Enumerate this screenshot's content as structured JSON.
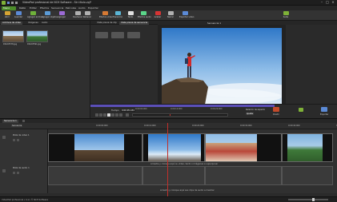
{
  "window": {
    "title": "VideoPad profesional de NCH Software - Sin título.vpj*"
  },
  "menubar": {
    "file_label": "Menú",
    "items": [
      "Inicio",
      "Editar",
      "Efectos",
      "Secuencia",
      "Películas",
      "Audio",
      "Exportar"
    ]
  },
  "ribbon": {
    "buttons": [
      {
        "label": "Abrir",
        "icon": "folder-icon",
        "color": "#d6a534"
      },
      {
        "label": "Guardar",
        "icon": "save-icon",
        "color": "#5b8ad6"
      },
      {
        "label": "Agregar archivo",
        "icon": "add-file-icon",
        "color": "#6fb13a"
      },
      {
        "label": "Agregar objetos",
        "icon": "add-objects-icon",
        "color": "#5b9bd6"
      },
      {
        "label": "Agregar",
        "icon": "add-icon",
        "color": "#9c6bd6"
      },
      {
        "label": "Deshacer",
        "icon": "undo-icon",
        "color": "#b0b0b0"
      },
      {
        "label": "Rehacer",
        "icon": "redo-icon",
        "color": "#b0b0b0"
      },
      {
        "label": "Efectos video",
        "icon": "video-effects-icon",
        "color": "#d67a34"
      },
      {
        "label": "Transición",
        "icon": "transition-icon",
        "color": "#5bb6d6"
      },
      {
        "label": "Texto",
        "icon": "text-icon",
        "color": "#e0e0e0"
      },
      {
        "label": "Efectos audio",
        "icon": "audio-effects-icon",
        "color": "#5bd68a"
      },
      {
        "label": "Grabar",
        "icon": "record-icon",
        "color": "#d63434"
      },
      {
        "label": "Narrar",
        "icon": "narrate-icon",
        "color": "#b0b0b0"
      },
      {
        "label": "Exportar video",
        "icon": "export-video-icon",
        "color": "#5b8ad6"
      },
      {
        "label": "Suite",
        "icon": "suite-icon",
        "color": "#7fb238"
      }
    ]
  },
  "left_panel": {
    "tabs": [
      "Archivos de video",
      "Imágenes",
      "Audio"
    ],
    "thumbs": [
      {
        "label": "DSC03578.jpg"
      },
      {
        "label": "DSC03591.jpg"
      }
    ]
  },
  "preview": {
    "tabs": [
      "Vista previa de clip",
      "Vista previa de secuencia"
    ],
    "sequence_label": "Secuencia 1",
    "time_start": "0:00:00.000",
    "time_mid": "0:00:10.000",
    "time_end": "0:00:20.000",
    "time_label": "Tiempo",
    "time_value": "0:00:05.434",
    "aspect_label": "Relación de aspecto",
    "aspect_value": "Ajustar",
    "split_label": "Dividir",
    "export_label": "Exportar",
    "snapshot_label": "Instantánea"
  },
  "timeline": {
    "sequence_tab": "Secuencia 1",
    "ruler_ticks": [
      "0:00:00.000",
      "0:00:10.000",
      "0:00:20.000",
      "0:00:30.000",
      "0:00:40.000",
      "0:00:50.000"
    ],
    "video_track_label": "Pista de video 1",
    "audio_track_label": "Pista de audio 1",
    "video_hint": "Arrastre y coloque aquí su video, texto o imágenes a superponer",
    "audio_hint": "Arrastre y coloque aquí sus clips de audio a mezclar",
    "zoom_label": "Secuencia"
  },
  "status": {
    "text": "VideoPad profesional v 4.xx © NCH Software"
  }
}
